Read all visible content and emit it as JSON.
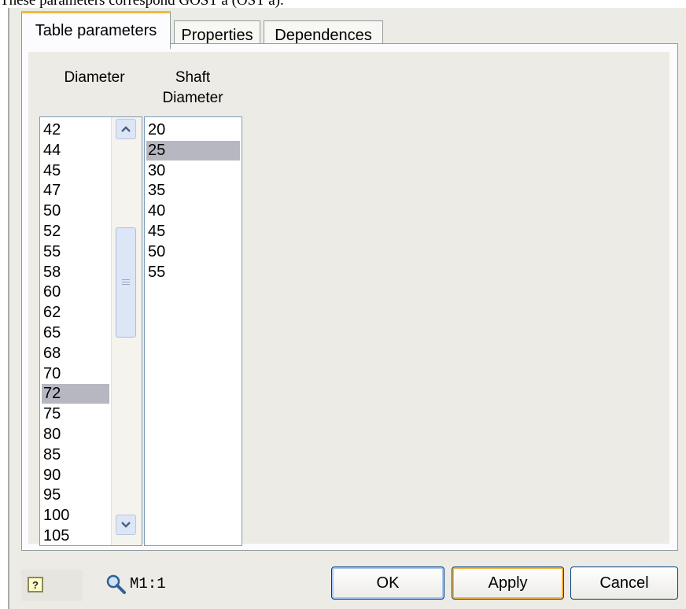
{
  "caption": "These parameters correspond GOST a (OST a).",
  "tabs": [
    {
      "label": "Table parameters",
      "active": true
    },
    {
      "label": "Properties",
      "active": false
    },
    {
      "label": "Dependences",
      "active": false
    }
  ],
  "columns": {
    "diameter": {
      "header": "Diameter",
      "items": [
        "42",
        "44",
        "45",
        "47",
        "50",
        "52",
        "55",
        "58",
        "60",
        "62",
        "65",
        "68",
        "70",
        "72",
        "75",
        "80",
        "85",
        "90",
        "95",
        "100",
        "105"
      ],
      "selected": "72"
    },
    "shaft_diameter": {
      "header_line1": "Shaft",
      "header_line2": "Diameter",
      "items": [
        "20",
        "25",
        "30",
        "35",
        "40",
        "45",
        "50",
        "55"
      ],
      "selected": "25"
    }
  },
  "footer": {
    "help_icon": "question-icon",
    "zoom_icon": "magnifier-icon",
    "scale": "M1:1",
    "ok_label": "OK",
    "apply_label": "Apply",
    "cancel_label": "Cancel"
  },
  "colors": {
    "selection": "#b7b7c2",
    "active_tab_accent": "#f0b83c",
    "dialog_bg": "#ecebe5"
  }
}
